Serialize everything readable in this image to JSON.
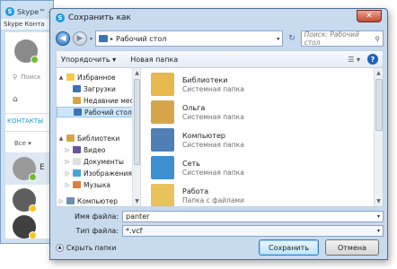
{
  "skype": {
    "title": "Skype™ - panteraa",
    "menu": "Skype  Конта",
    "search": "Поиск",
    "contacts_label": "КОНТАКТЫ",
    "filter": "Все",
    "letter": "E"
  },
  "dialog": {
    "title": "Сохранить как",
    "close": "✕",
    "path": "Рабочий стол",
    "search_placeholder": "Поиск: Рабочий стол",
    "toolbar": {
      "organize": "Упорядочить",
      "new_folder": "Новая папка"
    },
    "nav": [
      {
        "label": "Избранное",
        "arrow": "▲",
        "indent": 0
      },
      {
        "label": "Загрузки",
        "arrow": "",
        "indent": 1
      },
      {
        "label": "Недавние места",
        "arrow": "",
        "indent": 1
      },
      {
        "label": "Рабочий стол",
        "arrow": "",
        "indent": 1,
        "selected": true
      },
      {
        "label": "Библиотеки",
        "arrow": "▲",
        "indent": 0
      },
      {
        "label": "Видео",
        "arrow": "▷",
        "indent": 1
      },
      {
        "label": "Документы",
        "arrow": "▷",
        "indent": 1
      },
      {
        "label": "Изображения",
        "arrow": "▷",
        "indent": 1
      },
      {
        "label": "Музыка",
        "arrow": "▷",
        "indent": 1
      },
      {
        "label": "Компьютер",
        "arrow": "▷",
        "indent": 0
      }
    ],
    "files": [
      {
        "name": "Библиотеки",
        "type": "Системная папка"
      },
      {
        "name": "Ольга",
        "type": "Системная папка"
      },
      {
        "name": "Компьютер",
        "type": "Системная папка"
      },
      {
        "name": "Сеть",
        "type": "Системная папка"
      },
      {
        "name": "Работа",
        "type": "Папка с файлами"
      }
    ],
    "filename_label": "Имя файла:",
    "filename_value": "panter",
    "filetype_label": "Тип файла:",
    "filetype_value": "*.vcf",
    "hide_folders": "Скрыть папки",
    "save": "Сохранить",
    "cancel": "Отмена"
  }
}
